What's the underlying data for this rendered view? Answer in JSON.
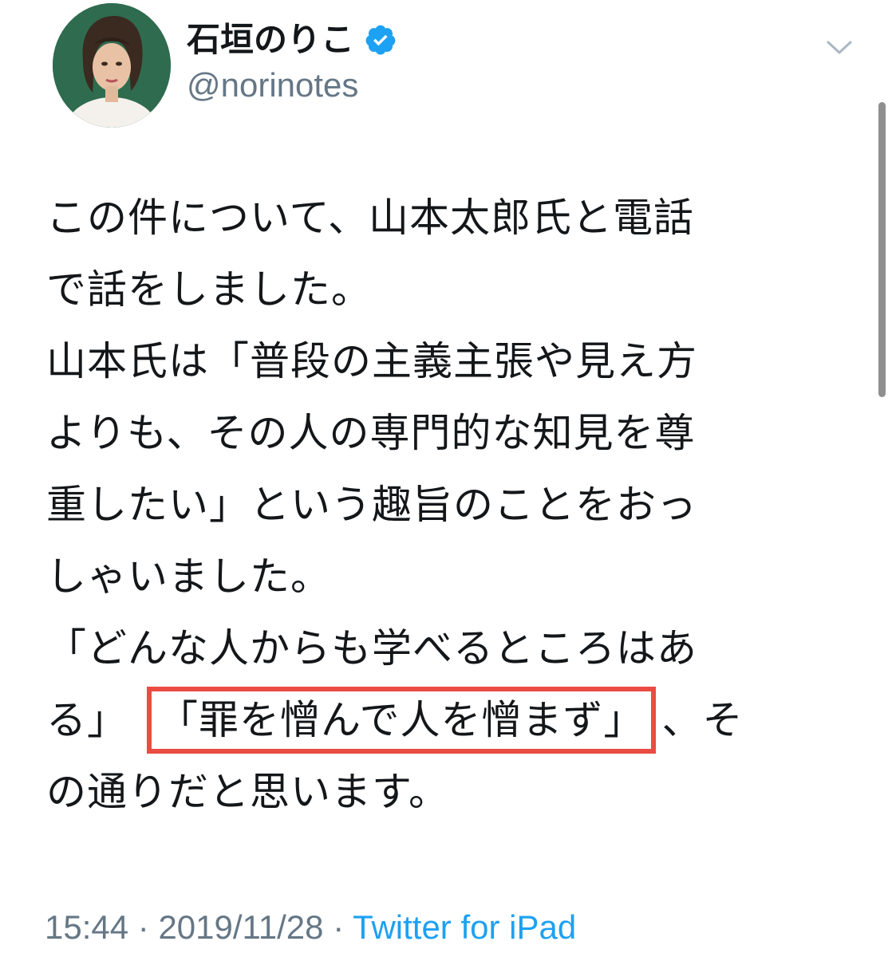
{
  "user": {
    "display_name": "石垣のりこ",
    "handle": "@norinotes",
    "verified_icon": "verified-badge-icon",
    "avatar_icon": "avatar-photo"
  },
  "header": {
    "menu_icon": "chevron-down-icon"
  },
  "tweet": {
    "lines": [
      "この件について、山本太郎氏と電話",
      "で話をしました。",
      "山本氏は「普段の主義主張や見え方",
      "よりも、その人の専門的な知見を尊",
      "重したい」という趣旨のことをおっ",
      "しゃいました。",
      "「どんな人からも学べるところはあ"
    ],
    "line8_before": "る」",
    "line8_highlight": "「罪を憎んで人を憎まず」",
    "line8_after": "、そ",
    "line9": "の通りだと思います。"
  },
  "meta": {
    "time": "15:44",
    "separator1": " · ",
    "date": "2019/11/28",
    "separator2": " · ",
    "source": "Twitter for iPad"
  },
  "colors": {
    "highlight_border": "#ea4c43",
    "link": "#1da1f2",
    "muted": "#657786",
    "verified": "#1da1f2"
  }
}
